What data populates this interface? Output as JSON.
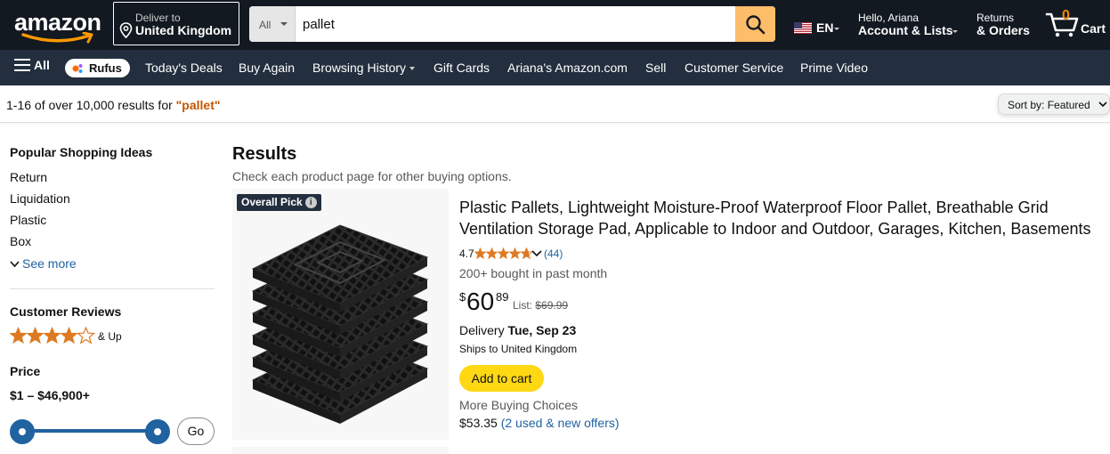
{
  "header": {
    "logo_text": "amazon",
    "deliver_line1": "Deliver to",
    "deliver_line2": "United Kingdom",
    "search_category": "All",
    "search_query": "pallet",
    "language": "EN",
    "account_line1": "Hello, Ariana",
    "account_line2": "Account & Lists",
    "orders_line1": "Returns",
    "orders_line2": "& Orders",
    "cart_count": "0",
    "cart_label": "Cart",
    "colors": {
      "nav_bg": "#131921",
      "subnav_bg": "#232f3e",
      "search_button": "#febd69",
      "cart_count": "#f08804"
    }
  },
  "subnav": {
    "all_label": "All",
    "rufus_label": "Rufus",
    "items": [
      "Today's Deals",
      "Buy Again",
      "Browsing History",
      "Gift Cards",
      "Ariana's Amazon.com",
      "Sell",
      "Customer Service",
      "Prime Video"
    ]
  },
  "results_bar": {
    "count_text": "1-16 of over 10,000 results for ",
    "keyword": "\"pallet\"",
    "sort_label": "Sort by:",
    "sort_value": "Featured"
  },
  "sidebar": {
    "ideas_heading": "Popular Shopping Ideas",
    "ideas": [
      "Return",
      "Liquidation",
      "Plastic",
      "Box"
    ],
    "see_more": "See more",
    "reviews_heading": "Customer Reviews",
    "reviews_stars": 4,
    "reviews_suffix": "& Up",
    "price_heading": "Price",
    "price_range": "$1 – $46,900+",
    "go_label": "Go"
  },
  "main": {
    "heading": "Results",
    "subheading": "Check each product page for other buying options."
  },
  "product": {
    "badge": "Overall Pick",
    "title_line1": "Plastic Pallets, Lightweight Moisture-Proof Waterproof Floor Pallet, Breathable Grid",
    "title_line2": "Ventilation Storage Pad, Applicable to Indoor and Outdoor, Garages, Kitchen, Basements",
    "rating": "4.7",
    "rating_value": 4.7,
    "rating_count": "(44)",
    "bought": "200+ bought in past month",
    "price_symbol": "$",
    "price_whole": "60",
    "price_fraction": "89",
    "list_label": "List:",
    "list_price": "$69.99",
    "delivery_label": "Delivery",
    "delivery_date": "Tue, Sep 23",
    "ships_to": "Ships to United Kingdom",
    "add_to_cart": "Add to cart",
    "more_choices": "More Buying Choices",
    "offer_price": "$53.35",
    "offer_link": "(2 used & new offers)",
    "colors": {
      "badge_bg": "#232f3e",
      "add_to_cart": "#ffd814",
      "star": "#de7921",
      "link": "#2162a1"
    }
  }
}
